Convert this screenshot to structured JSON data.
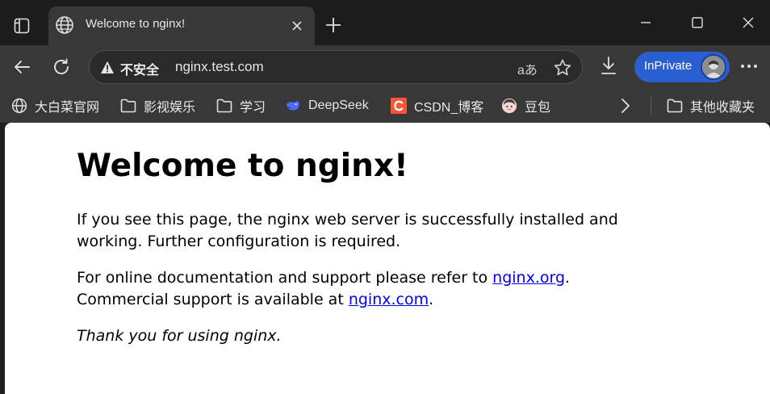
{
  "tab": {
    "title": "Welcome to nginx!"
  },
  "address_bar": {
    "security_label": "不安全",
    "url": "nginx.test.com",
    "read_aloud_glyph": "aあ"
  },
  "profile": {
    "label": "InPrivate"
  },
  "favorites": {
    "items": [
      {
        "label": "大白菜官网",
        "icon": "globe-icon"
      },
      {
        "label": "影视娱乐",
        "icon": "folder-icon"
      },
      {
        "label": "学习",
        "icon": "folder-icon"
      },
      {
        "label": "DeepSeek",
        "icon": "deepseek-icon"
      },
      {
        "label": "CSDN_博客",
        "icon": "csdn-icon"
      },
      {
        "label": "豆包",
        "icon": "doubao-icon"
      }
    ],
    "other_folder": "其他收藏夹"
  },
  "page": {
    "heading": "Welcome to nginx!",
    "para1": "If you see this page, the nginx web server is successfully installed and working. Further configuration is required.",
    "para2_before": "For online documentation and support please refer to ",
    "para2_link1": "nginx.org",
    "para2_middle": ". Commercial support is available at ",
    "para2_link2": "nginx.com",
    "para2_after": ".",
    "thanks": "Thank you for using nginx."
  },
  "colors": {
    "inprivate_accent": "#2a5fd1",
    "link": "#0000ee",
    "chrome_dark": "#1c1c1c",
    "chrome_mid": "#383838"
  }
}
